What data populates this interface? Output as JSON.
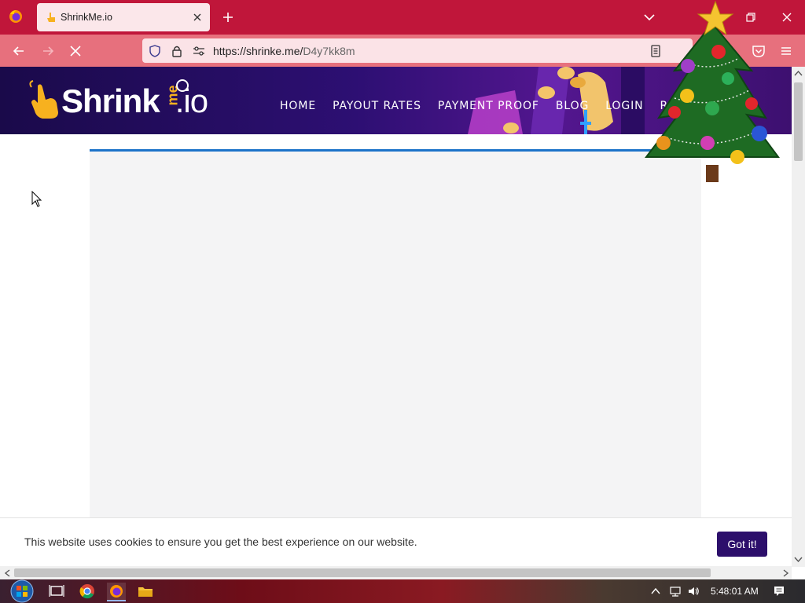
{
  "browser": {
    "tab": {
      "title": "ShrinkMe.io"
    },
    "url": {
      "host": "https://shrinke.me/",
      "path": "D4y7kk8m"
    }
  },
  "site": {
    "logo": {
      "main": "Shrink",
      "me": "me",
      "suffix": ".io"
    },
    "nav": [
      "HOME",
      "PAYOUT RATES",
      "PAYMENT PROOF",
      "BLOG",
      "LOGIN",
      "RE"
    ]
  },
  "cookie_bar": {
    "message": "This website uses cookies to ensure you get the best experience on our website.",
    "button": "Got it!"
  },
  "taskbar": {
    "clock": "5:48:01 AM"
  },
  "colors": {
    "tabbar": "#c0163a",
    "toolbar": "#e7707d",
    "header": "#2d0f73",
    "accent_blue": "#1c73c9",
    "cookie_button": "#2c0f6b"
  },
  "icons": [
    "firefox-icon",
    "close-icon",
    "plus-icon",
    "chevron-down-icon",
    "restore-icon",
    "back-icon",
    "forward-icon",
    "stop-icon",
    "shield-icon",
    "lock-icon",
    "permissions-icon",
    "reader-view-icon",
    "bookmark-star-icon",
    "pocket-icon",
    "hamburger-menu-icon",
    "windows-start-icon",
    "task-view-icon",
    "chrome-icon",
    "file-explorer-icon",
    "network-icon",
    "volume-icon",
    "notifications-icon"
  ]
}
